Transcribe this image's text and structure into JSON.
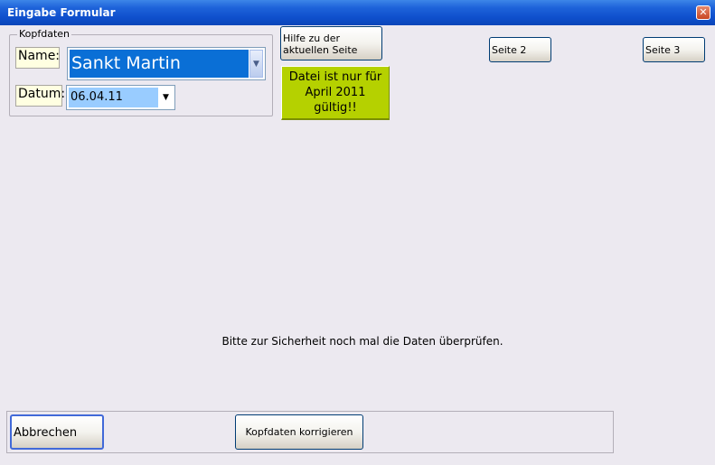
{
  "window": {
    "title": "Eingabe Formular",
    "close_glyph": "✕"
  },
  "kopfdaten": {
    "legend": "Kopfdaten",
    "name_label": "Name:",
    "name_value": "Sankt Martin",
    "datum_label": "Datum:",
    "datum_value": "06.04.11"
  },
  "buttons": {
    "help_line1": "Hilfe zu der",
    "help_line2": "aktuellen Seite",
    "seite2": "Seite 2",
    "seite3": "Seite 3",
    "abbrechen": "Abbrechen",
    "kopfdaten_korrigieren": "Kopfdaten korrigieren"
  },
  "notice": {
    "line1": "Datei ist nur für",
    "line2": "April 2011 gültig!!"
  },
  "message": "Bitte zur Sicherheit noch mal die Daten überprüfen.",
  "icons": {
    "dropdown": "chevron-down-icon",
    "close": "close-icon"
  },
  "colors": {
    "titlebar": "#0F4FCC",
    "selection": "#0A6FD6",
    "notice_bg": "#B5D100",
    "label_bg": "#FFFFE1"
  }
}
